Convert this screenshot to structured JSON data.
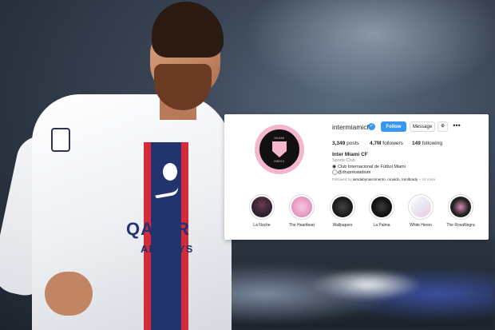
{
  "profile": {
    "username": "intermiamicf",
    "verified_icon": "✓",
    "follow_label": "Follow",
    "message_label": "Message",
    "suggest_icon": "⊥⁺",
    "more_icon": "•••",
    "avatar": {
      "ring_text_top": "CLUB INTERNACIONAL DE FÚTBOL",
      "center_text": "MIAMI",
      "bottom_text": "MMXX"
    },
    "stats": {
      "posts_num": "3,349",
      "posts_label": "posts",
      "followers_num": "4.7M",
      "followers_label": "followers",
      "following_num": "149",
      "following_label": "following"
    },
    "bio": {
      "name": "Inter Miami CF",
      "category": "Sports Club",
      "line1": "Club Internacional de Fútbol Miami",
      "line2": "@drvpnkstadium"
    },
    "followed_by": {
      "prefix": "Followed by",
      "names": "iamdebynascimento, ronaldo, tomlbrady",
      "suffix": "+ 16 more"
    }
  },
  "highlights": [
    {
      "label": "La Noche",
      "color": "#2a1f2b"
    },
    {
      "label": "The Heartbeat",
      "color": "#e79ac4"
    },
    {
      "label": "Wallpapers",
      "color": "#1a1a1a"
    },
    {
      "label": "La Palma",
      "color": "#111111"
    },
    {
      "label": "White Heron",
      "color": "#e8e6ee"
    },
    {
      "label": "The RosaNegra",
      "color": "#222222"
    }
  ],
  "photo": {
    "shirt_sponsor": "QATAR",
    "shirt_sponsor_sub": "AIRWAYS"
  },
  "colors": {
    "instagram_blue": "#3897f0",
    "miami_pink": "#f4b6cf",
    "psg_navy": "#22336d",
    "psg_red": "#d52b3a"
  }
}
